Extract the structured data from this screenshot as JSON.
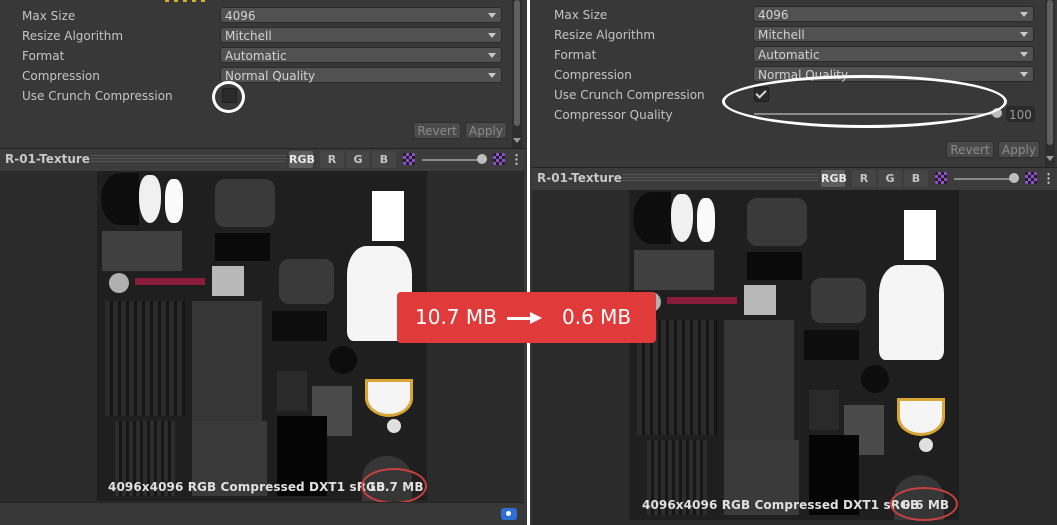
{
  "left": {
    "properties": [
      {
        "label": "Max Size",
        "value": "4096"
      },
      {
        "label": "Resize Algorithm",
        "value": "Mitchell"
      },
      {
        "label": "Format",
        "value": "Automatic"
      },
      {
        "label": "Compression",
        "value": "Normal Quality"
      }
    ],
    "crunch": {
      "label": "Use Crunch Compression",
      "checked": false
    },
    "buttons": {
      "revert": "Revert",
      "apply": "Apply"
    },
    "preview": {
      "title": "R-01-Texture",
      "channels": [
        "RGB",
        "R",
        "G",
        "B"
      ],
      "info": "4096x4096  RGB Compressed DXT1 sRGB",
      "size": "10.7 MB"
    }
  },
  "right": {
    "properties": [
      {
        "label": "Max Size",
        "value": "4096"
      },
      {
        "label": "Resize Algorithm",
        "value": "Mitchell"
      },
      {
        "label": "Format",
        "value": "Automatic"
      },
      {
        "label": "Compression",
        "value": "Normal Quality"
      }
    ],
    "crunch": {
      "label": "Use Crunch Compression",
      "checked": true
    },
    "compressor_quality": {
      "label": "Compressor Quality",
      "value": "100"
    },
    "buttons": {
      "revert": "Revert",
      "apply": "Apply"
    },
    "preview": {
      "title": "R-01-Texture",
      "channels": [
        "RGB",
        "R",
        "G",
        "B"
      ],
      "info": "4096x4096  RGB Compressed DXT1 sRGB",
      "size": "0.6 MB"
    }
  },
  "callout": {
    "from": "10.7 MB",
    "to": "0.6 MB"
  },
  "colors": {
    "highlight": "#c94040",
    "callout_bg": "#e03a3a",
    "panel_bg": "#383838"
  }
}
